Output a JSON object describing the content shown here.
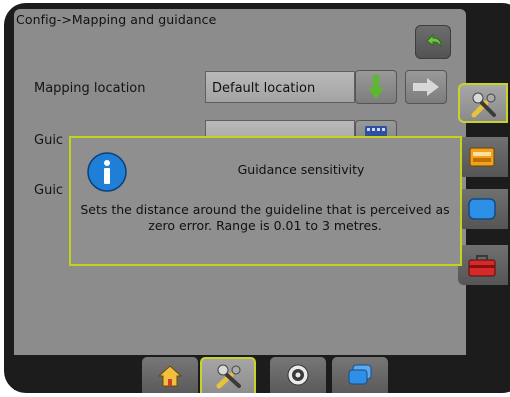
{
  "header": {
    "breadcrumb": "Config->Mapping and guidance"
  },
  "rows": [
    {
      "label": "Mapping location",
      "value": "Default location"
    },
    {
      "label": "Guic",
      "value": ""
    },
    {
      "label": "Guic",
      "value": ""
    }
  ],
  "dialog": {
    "title": "Guidance sensitivity",
    "body": "Sets the distance around the guideline that is perceived as zero error. Range is 0.01 to 3 metres."
  },
  "colors": {
    "accent": "#c4d21a",
    "arrow_green": "#5cb82c",
    "screen_bg": "#8c8c8c"
  },
  "icons": {
    "header": "back-arrow-icon",
    "side_tabs": [
      "tools-icon",
      "console-icon",
      "screen-icon",
      "toolbox-icon"
    ],
    "bottom_tabs": [
      "home-icon",
      "tools-icon",
      "gauge-icon",
      "layers-icon"
    ]
  }
}
